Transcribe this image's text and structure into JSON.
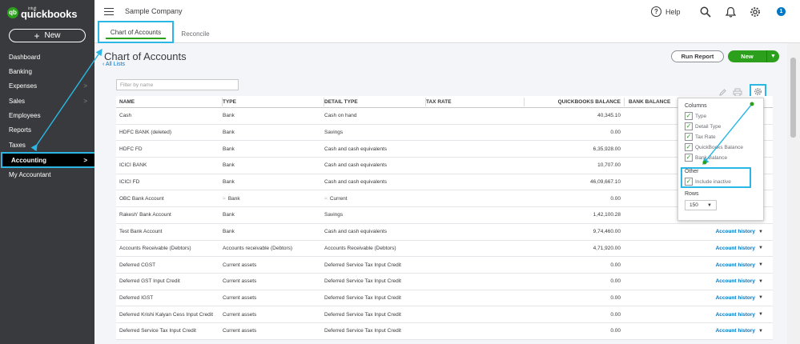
{
  "brand": {
    "small": "intuit",
    "name": "quickbooks"
  },
  "sidebar": {
    "new_label": "New",
    "items": [
      {
        "label": "Dashboard",
        "chevron": ""
      },
      {
        "label": "Banking",
        "chevron": ""
      },
      {
        "label": "Expenses",
        "chevron": ">"
      },
      {
        "label": "Sales",
        "chevron": ">"
      },
      {
        "label": "Employees",
        "chevron": ""
      },
      {
        "label": "Reports",
        "chevron": ""
      },
      {
        "label": "Taxes",
        "chevron": ""
      },
      {
        "label": "Accounting",
        "chevron": ">"
      },
      {
        "label": "My Accountant",
        "chevron": ""
      }
    ]
  },
  "topbar": {
    "company": "Sample Company",
    "help": "Help",
    "notification_count": "1"
  },
  "tabs": [
    {
      "label": "Chart of Accounts"
    },
    {
      "label": "Reconcile"
    }
  ],
  "page": {
    "title": "Chart of Accounts",
    "all_lists": "All Lists",
    "run_report": "Run Report",
    "new": "New"
  },
  "filter": {
    "placeholder": "Filter by name"
  },
  "table": {
    "headers": [
      "NAME",
      "TYPE",
      "DETAIL TYPE",
      "TAX RATE",
      "QUICKBOOKS BALANCE",
      "BANK BALANCE"
    ],
    "action_label": "Account history",
    "rows": [
      {
        "name": "Cash",
        "type": "Bank",
        "detail": "Cash on hand",
        "tax": "",
        "qb": "40,345.10",
        "action": false,
        "glyph": false
      },
      {
        "name": "HDFC BANK (deleted)",
        "type": "Bank",
        "detail": "Savings",
        "tax": "",
        "qb": "0.00",
        "action": false,
        "glyph": false
      },
      {
        "name": "HDFC FD",
        "type": "Bank",
        "detail": "Cash and cash equivalents",
        "tax": "",
        "qb": "6,35,928.00",
        "action": false,
        "glyph": false
      },
      {
        "name": "ICICI BANK",
        "type": "Bank",
        "detail": "Cash and cash equivalents",
        "tax": "",
        "qb": "10,707.00",
        "action": false,
        "glyph": false
      },
      {
        "name": "ICICI FD",
        "type": "Bank",
        "detail": "Cash and cash equivalents",
        "tax": "",
        "qb": "46,09,667.10",
        "action": false,
        "glyph": false
      },
      {
        "name": "OBC Bank Account",
        "type": "Bank",
        "detail": "Current",
        "tax": "",
        "qb": "0.00",
        "action": false,
        "glyph": true
      },
      {
        "name": "Rakesh' Bank Account",
        "type": "Bank",
        "detail": "Savings",
        "tax": "",
        "qb": "1,42,100.28",
        "action": false,
        "glyph": false
      },
      {
        "name": "Test Bank Account",
        "type": "Bank",
        "detail": "Cash and cash equivalents",
        "tax": "",
        "qb": "9,74,460.00",
        "action": true,
        "glyph": false
      },
      {
        "name": "Accounts Receivable (Debtors)",
        "type": "Accounts receivable (Debtors)",
        "detail": "Accounts Receivable (Debtors)",
        "tax": "",
        "qb": "4,71,920.00",
        "action": true,
        "glyph": false
      },
      {
        "name": "Deferred CGST",
        "type": "Current assets",
        "detail": "Deferred Service Tax Input Credit",
        "tax": "",
        "qb": "0.00",
        "action": true,
        "glyph": false
      },
      {
        "name": "Deferred GST Input Credit",
        "type": "Current assets",
        "detail": "Deferred Service Tax Input Credit",
        "tax": "",
        "qb": "0.00",
        "action": true,
        "glyph": false
      },
      {
        "name": "Deferred IGST",
        "type": "Current assets",
        "detail": "Deferred Service Tax Input Credit",
        "tax": "",
        "qb": "0.00",
        "action": true,
        "glyph": false
      },
      {
        "name": "Deferred Krishi Kalyan Cess Input Credit",
        "type": "Current assets",
        "detail": "Deferred Service Tax Input Credit",
        "tax": "",
        "qb": "0.00",
        "action": true,
        "glyph": false
      },
      {
        "name": "Deferred Service Tax Input Credit",
        "type": "Current assets",
        "detail": "Deferred Service Tax Input Credit",
        "tax": "",
        "qb": "0.00",
        "action": true,
        "glyph": false
      }
    ]
  },
  "settings": {
    "columns_heading": "Columns",
    "columns": [
      {
        "label": "Type",
        "checked": true
      },
      {
        "label": "Detail Type",
        "checked": true
      },
      {
        "label": "Tax Rate",
        "checked": true
      },
      {
        "label": "QuickBooks Balance",
        "checked": true
      },
      {
        "label": "Bank Balance",
        "checked": true
      }
    ],
    "other_heading": "Other",
    "include_inactive": {
      "label": "Include inactive",
      "checked": true
    },
    "rows_heading": "Rows",
    "rows_value": "150"
  },
  "colors": {
    "sidebar": "#393a3d",
    "accent_green": "#2ca01c",
    "link_blue": "#0077c5",
    "highlight": "#2ab7e6"
  }
}
